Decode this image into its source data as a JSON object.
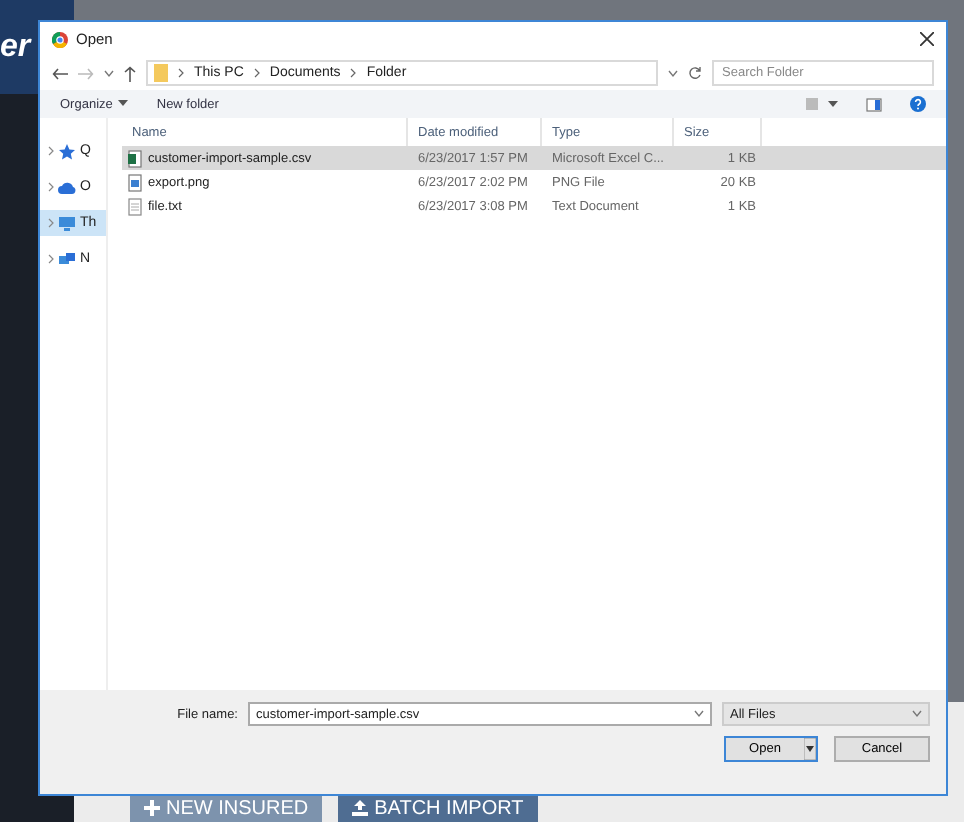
{
  "background": {
    "brand_text": "er",
    "buttons": [
      {
        "label": "NEW INSURED",
        "kind": "plus"
      },
      {
        "label": "BATCH IMPORT",
        "kind": "upload"
      }
    ]
  },
  "dialog": {
    "title": "Open",
    "address": {
      "path": [
        "This PC",
        "Documents",
        "Folder"
      ]
    },
    "search": {
      "placeholder": "Search Folder"
    },
    "toolbar": {
      "organize": "Organize",
      "new_folder": "New folder"
    },
    "nav_pane": [
      {
        "label": "Q",
        "kind": "star",
        "selected": false
      },
      {
        "label": "O",
        "kind": "cloud",
        "selected": false
      },
      {
        "label": "Th",
        "kind": "pc",
        "selected": true
      },
      {
        "label": "N",
        "kind": "network",
        "selected": false
      }
    ],
    "columns": [
      "Name",
      "Date modified",
      "Type",
      "Size"
    ],
    "rows": [
      {
        "name": "customer-import-sample.csv",
        "date": "6/23/2017 1:57 PM",
        "type": "Microsoft Excel C...",
        "size": "1 KB",
        "kind": "excel",
        "selected": true
      },
      {
        "name": "export.png",
        "date": "6/23/2017 2:02 PM",
        "type": "PNG File",
        "size": "20 KB",
        "kind": "image",
        "selected": false
      },
      {
        "name": "file.txt",
        "date": "6/23/2017 3:08 PM",
        "type": "Text Document",
        "size": "1 KB",
        "kind": "text",
        "selected": false
      }
    ],
    "file_name_label": "File name:",
    "file_name": "customer-import-sample.csv",
    "file_type": "All Files",
    "buttons": {
      "open": "Open",
      "cancel": "Cancel"
    }
  }
}
